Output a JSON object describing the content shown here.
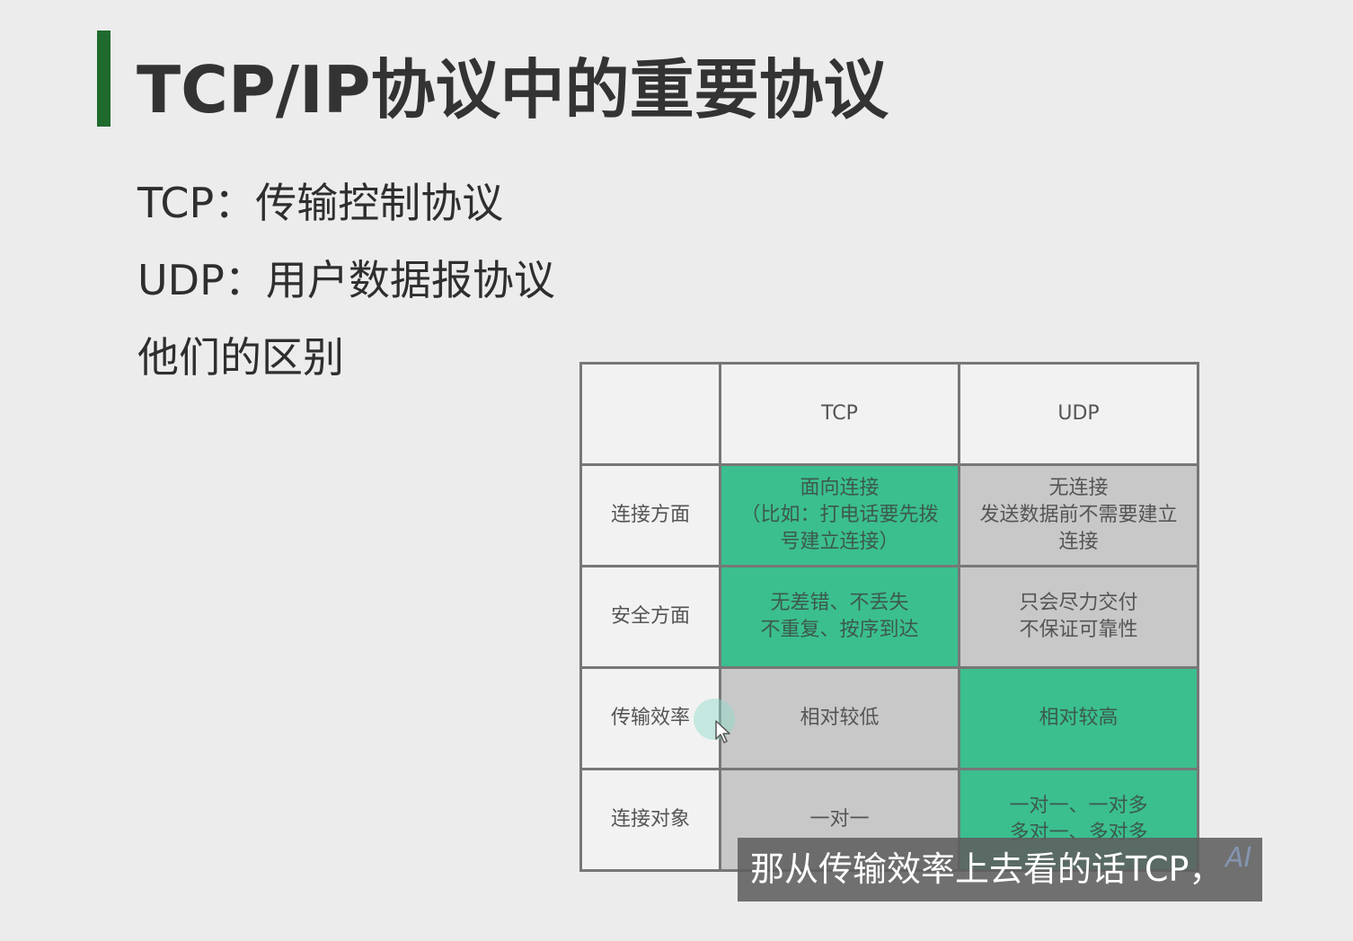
{
  "slide": {
    "title": "TCP/IP协议中的重要协议",
    "lines": [
      "TCP：传输控制协议",
      "UDP：用户数据报协议",
      "他们的区别"
    ]
  },
  "table": {
    "headers": [
      "",
      "TCP",
      "UDP"
    ],
    "rows": [
      {
        "label": "连接方面",
        "tcp": [
          "面向连接",
          "（比如：打电话要先拨",
          "号建立连接）"
        ],
        "udp": [
          "无连接",
          "发送数据前不需要建立",
          "连接"
        ]
      },
      {
        "label": "安全方面",
        "tcp": [
          "无差错、不丢失",
          "不重复、按序到达"
        ],
        "udp": [
          "只会尽力交付",
          "不保证可靠性"
        ]
      },
      {
        "label": "传输效率",
        "tcp": [
          "相对较低"
        ],
        "udp": [
          "相对较高"
        ]
      },
      {
        "label": "连接对象",
        "tcp": [
          "一对一"
        ],
        "udp": [
          "一对一、一对多",
          "多对一、多对多"
        ]
      }
    ],
    "colors": {
      "highlight": "#3bbf8f",
      "neutral": "#c8c8c8",
      "blank": "#f2f2f2"
    }
  },
  "subtitle": {
    "text": "那从传输效率上去看的话TCP，",
    "watermark": "AI"
  },
  "colors": {
    "title_bar": "#1f6b2e",
    "background": "#ececec"
  },
  "icons": {
    "cursor": "mouse-pointer-icon"
  }
}
